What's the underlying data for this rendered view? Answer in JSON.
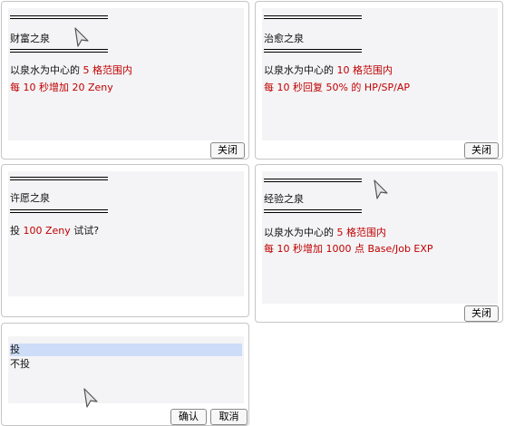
{
  "dialogs": {
    "wealth": {
      "title": "财富之泉",
      "line1": {
        "prefix": "以泉水为中心的 ",
        "highlight": "5 格范围内"
      },
      "line2": "每 10 秒增加 20 Zeny",
      "close_label": "关闭"
    },
    "heal": {
      "title": "治愈之泉",
      "line1": {
        "prefix": "以泉水为中心的 ",
        "highlight": "10 格范围内"
      },
      "line2": "每 10 秒回复 50% 的 HP/SP/AP",
      "close_label": "关闭"
    },
    "wish": {
      "title": "许愿之泉",
      "line1": {
        "prefix": "投 ",
        "highlight": "100 Zeny",
        "suffix": " 试试?"
      }
    },
    "exp": {
      "title": "经验之泉",
      "line1": {
        "prefix": "以泉水为中心的 ",
        "highlight": "5 格范围内"
      },
      "line2": "每 10 秒增加 1000 点 Base/Job EXP",
      "close_label": "关闭"
    },
    "choice": {
      "options": [
        "投",
        "不投"
      ],
      "selected_index": 0,
      "ok_label": "确认",
      "cancel_label": "取消"
    }
  },
  "colors": {
    "highlight": "#c00000",
    "content_bg": "#f4f4f6",
    "selection": "#cddcf7"
  }
}
